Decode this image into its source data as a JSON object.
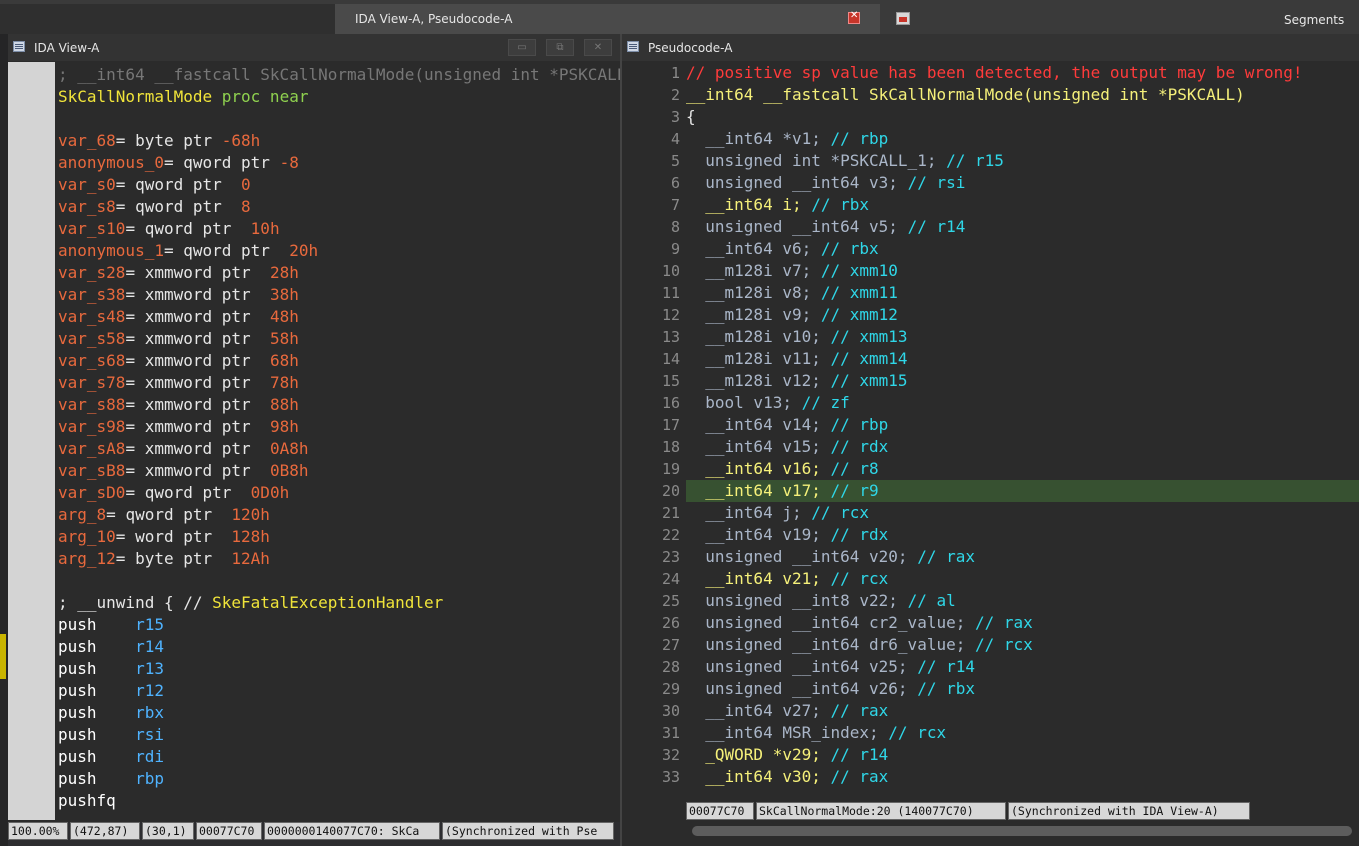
{
  "tabs": {
    "main_title": "IDA View-A, Pseudocode-A",
    "segments": "Segments"
  },
  "left_pane": {
    "title": "IDA View-A",
    "lines": [
      [
        {
          "t": "; __int64 __fastcall SkCallNormalMode(unsigned int *PSKCALL",
          "c": "#777777"
        }
      ],
      [
        {
          "t": "SkCallNormalMode ",
          "c": "#f0e43a"
        },
        {
          "t": "proc near",
          "c": "#8fd14f"
        }
      ],
      [
        {
          "t": "",
          "c": "#fff"
        }
      ],
      [
        {
          "t": "var_68",
          "c": "#e8693d"
        },
        {
          "t": "= byte ptr ",
          "c": "#e6e6e6"
        },
        {
          "t": "-68h",
          "c": "#e8693d"
        }
      ],
      [
        {
          "t": "anonymous_0",
          "c": "#e8693d"
        },
        {
          "t": "= qword ptr ",
          "c": "#e6e6e6"
        },
        {
          "t": "-8",
          "c": "#e8693d"
        }
      ],
      [
        {
          "t": "var_s0",
          "c": "#e8693d"
        },
        {
          "t": "= qword ptr  ",
          "c": "#e6e6e6"
        },
        {
          "t": "0",
          "c": "#e8693d"
        }
      ],
      [
        {
          "t": "var_s8",
          "c": "#e8693d"
        },
        {
          "t": "= qword ptr  ",
          "c": "#e6e6e6"
        },
        {
          "t": "8",
          "c": "#e8693d"
        }
      ],
      [
        {
          "t": "var_s10",
          "c": "#e8693d"
        },
        {
          "t": "= qword ptr  ",
          "c": "#e6e6e6"
        },
        {
          "t": "10h",
          "c": "#e8693d"
        }
      ],
      [
        {
          "t": "anonymous_1",
          "c": "#e8693d"
        },
        {
          "t": "= qword ptr  ",
          "c": "#e6e6e6"
        },
        {
          "t": "20h",
          "c": "#e8693d"
        }
      ],
      [
        {
          "t": "var_s28",
          "c": "#e8693d"
        },
        {
          "t": "= xmmword ptr  ",
          "c": "#e6e6e6"
        },
        {
          "t": "28h",
          "c": "#e8693d"
        }
      ],
      [
        {
          "t": "var_s38",
          "c": "#e8693d"
        },
        {
          "t": "= xmmword ptr  ",
          "c": "#e6e6e6"
        },
        {
          "t": "38h",
          "c": "#e8693d"
        }
      ],
      [
        {
          "t": "var_s48",
          "c": "#e8693d"
        },
        {
          "t": "= xmmword ptr  ",
          "c": "#e6e6e6"
        },
        {
          "t": "48h",
          "c": "#e8693d"
        }
      ],
      [
        {
          "t": "var_s58",
          "c": "#e8693d"
        },
        {
          "t": "= xmmword ptr  ",
          "c": "#e6e6e6"
        },
        {
          "t": "58h",
          "c": "#e8693d"
        }
      ],
      [
        {
          "t": "var_s68",
          "c": "#e8693d"
        },
        {
          "t": "= xmmword ptr  ",
          "c": "#e6e6e6"
        },
        {
          "t": "68h",
          "c": "#e8693d"
        }
      ],
      [
        {
          "t": "var_s78",
          "c": "#e8693d"
        },
        {
          "t": "= xmmword ptr  ",
          "c": "#e6e6e6"
        },
        {
          "t": "78h",
          "c": "#e8693d"
        }
      ],
      [
        {
          "t": "var_s88",
          "c": "#e8693d"
        },
        {
          "t": "= xmmword ptr  ",
          "c": "#e6e6e6"
        },
        {
          "t": "88h",
          "c": "#e8693d"
        }
      ],
      [
        {
          "t": "var_s98",
          "c": "#e8693d"
        },
        {
          "t": "= xmmword ptr  ",
          "c": "#e6e6e6"
        },
        {
          "t": "98h",
          "c": "#e8693d"
        }
      ],
      [
        {
          "t": "var_sA8",
          "c": "#e8693d"
        },
        {
          "t": "= xmmword ptr  ",
          "c": "#e6e6e6"
        },
        {
          "t": "0A8h",
          "c": "#e8693d"
        }
      ],
      [
        {
          "t": "var_sB8",
          "c": "#e8693d"
        },
        {
          "t": "= xmmword ptr  ",
          "c": "#e6e6e6"
        },
        {
          "t": "0B8h",
          "c": "#e8693d"
        }
      ],
      [
        {
          "t": "var_sD0",
          "c": "#e8693d"
        },
        {
          "t": "= qword ptr  ",
          "c": "#e6e6e6"
        },
        {
          "t": "0D0h",
          "c": "#e8693d"
        }
      ],
      [
        {
          "t": "arg_8",
          "c": "#e8693d"
        },
        {
          "t": "= qword ptr  ",
          "c": "#e6e6e6"
        },
        {
          "t": "120h",
          "c": "#e8693d"
        }
      ],
      [
        {
          "t": "arg_10",
          "c": "#e8693d"
        },
        {
          "t": "= word ptr  ",
          "c": "#e6e6e6"
        },
        {
          "t": "128h",
          "c": "#e8693d"
        }
      ],
      [
        {
          "t": "arg_12",
          "c": "#e8693d"
        },
        {
          "t": "= byte ptr  ",
          "c": "#e6e6e6"
        },
        {
          "t": "12Ah",
          "c": "#e8693d"
        }
      ],
      [
        {
          "t": "",
          "c": "#fff"
        }
      ],
      [
        {
          "t": "; __unwind { // ",
          "c": "#e6e6e6"
        },
        {
          "t": "SkeFatalExceptionHandler",
          "c": "#f0e43a"
        }
      ],
      [
        {
          "t": "push    ",
          "c": "#ffffff"
        },
        {
          "t": "r15",
          "c": "#4fb3ff"
        }
      ],
      [
        {
          "t": "push    ",
          "c": "#ffffff"
        },
        {
          "t": "r14",
          "c": "#4fb3ff"
        }
      ],
      [
        {
          "t": "push    ",
          "c": "#ffffff"
        },
        {
          "t": "r13",
          "c": "#4fb3ff"
        }
      ],
      [
        {
          "t": "push    ",
          "c": "#ffffff"
        },
        {
          "t": "r12",
          "c": "#4fb3ff"
        }
      ],
      [
        {
          "t": "push    ",
          "c": "#ffffff"
        },
        {
          "t": "rbx",
          "c": "#4fb3ff"
        }
      ],
      [
        {
          "t": "push    ",
          "c": "#ffffff"
        },
        {
          "t": "rsi",
          "c": "#4fb3ff"
        }
      ],
      [
        {
          "t": "push    ",
          "c": "#ffffff"
        },
        {
          "t": "rdi",
          "c": "#4fb3ff"
        }
      ],
      [
        {
          "t": "push    ",
          "c": "#ffffff"
        },
        {
          "t": "rbp",
          "c": "#4fb3ff"
        }
      ],
      [
        {
          "t": "pushfq",
          "c": "#ffffff"
        }
      ]
    ],
    "status": [
      "100.00%",
      "(472,87)",
      "(30,1)",
      "00077C70",
      "0000000140077C70: SkCa",
      "(Synchronized with Pse"
    ]
  },
  "right_pane": {
    "title": "Pseudocode-A",
    "lines": [
      [
        {
          "t": "// positive sp value has been detected, the output may be wrong!",
          "c": "#ff3b3b"
        }
      ],
      [
        {
          "t": "__int64 __fastcall SkCallNormalMode(unsigned int *PSKCALL)",
          "c": "#f5f07a"
        }
      ],
      [
        {
          "t": "{",
          "c": "#e6e6e6"
        }
      ],
      [
        {
          "t": "  __int64 *v1; ",
          "c": "#aab6c8"
        },
        {
          "t": "// rbp",
          "c": "#2fd7e8"
        }
      ],
      [
        {
          "t": "  unsigned int *PSKCALL_1; ",
          "c": "#aab6c8"
        },
        {
          "t": "// r15",
          "c": "#2fd7e8"
        }
      ],
      [
        {
          "t": "  unsigned __int64 v3; ",
          "c": "#aab6c8"
        },
        {
          "t": "// rsi",
          "c": "#2fd7e8"
        }
      ],
      [
        {
          "t": "  __int64 i; ",
          "c": "#f5f07a"
        },
        {
          "t": "// rbx",
          "c": "#2fd7e8"
        }
      ],
      [
        {
          "t": "  unsigned __int64 v5; ",
          "c": "#aab6c8"
        },
        {
          "t": "// r14",
          "c": "#2fd7e8"
        }
      ],
      [
        {
          "t": "  __int64 v6; ",
          "c": "#aab6c8"
        },
        {
          "t": "// rbx",
          "c": "#2fd7e8"
        }
      ],
      [
        {
          "t": "  __m128i v7; ",
          "c": "#aab6c8"
        },
        {
          "t": "// xmm10",
          "c": "#2fd7e8"
        }
      ],
      [
        {
          "t": "  __m128i v8; ",
          "c": "#aab6c8"
        },
        {
          "t": "// xmm11",
          "c": "#2fd7e8"
        }
      ],
      [
        {
          "t": "  __m128i v9; ",
          "c": "#aab6c8"
        },
        {
          "t": "// xmm12",
          "c": "#2fd7e8"
        }
      ],
      [
        {
          "t": "  __m128i v10; ",
          "c": "#aab6c8"
        },
        {
          "t": "// xmm13",
          "c": "#2fd7e8"
        }
      ],
      [
        {
          "t": "  __m128i v11; ",
          "c": "#aab6c8"
        },
        {
          "t": "// xmm14",
          "c": "#2fd7e8"
        }
      ],
      [
        {
          "t": "  __m128i v12; ",
          "c": "#aab6c8"
        },
        {
          "t": "// xmm15",
          "c": "#2fd7e8"
        }
      ],
      [
        {
          "t": "  bool v13; ",
          "c": "#aab6c8"
        },
        {
          "t": "// zf",
          "c": "#2fd7e8"
        }
      ],
      [
        {
          "t": "  __int64 v14; ",
          "c": "#aab6c8"
        },
        {
          "t": "// rbp",
          "c": "#2fd7e8"
        }
      ],
      [
        {
          "t": "  __int64 v15; ",
          "c": "#aab6c8"
        },
        {
          "t": "// rdx",
          "c": "#2fd7e8"
        }
      ],
      [
        {
          "t": "  __int64 v16; ",
          "c": "#f5f07a"
        },
        {
          "t": "// r8",
          "c": "#2fd7e8"
        }
      ],
      [
        {
          "t": "  __int64 v17; ",
          "c": "#f5f07a"
        },
        {
          "t": "// r9",
          "c": "#2fd7e8"
        }
      ],
      [
        {
          "t": "  __int64 j; ",
          "c": "#aab6c8"
        },
        {
          "t": "// rcx",
          "c": "#2fd7e8"
        }
      ],
      [
        {
          "t": "  __int64 v19; ",
          "c": "#aab6c8"
        },
        {
          "t": "// rdx",
          "c": "#2fd7e8"
        }
      ],
      [
        {
          "t": "  unsigned __int64 v20; ",
          "c": "#aab6c8"
        },
        {
          "t": "// rax",
          "c": "#2fd7e8"
        }
      ],
      [
        {
          "t": "  __int64 v21; ",
          "c": "#f5f07a"
        },
        {
          "t": "// rcx",
          "c": "#2fd7e8"
        }
      ],
      [
        {
          "t": "  unsigned __int8 v22; ",
          "c": "#aab6c8"
        },
        {
          "t": "// al",
          "c": "#2fd7e8"
        }
      ],
      [
        {
          "t": "  unsigned __int64 cr2_value; ",
          "c": "#aab6c8"
        },
        {
          "t": "// rax",
          "c": "#2fd7e8"
        }
      ],
      [
        {
          "t": "  unsigned __int64 dr6_value; ",
          "c": "#aab6c8"
        },
        {
          "t": "// rcx",
          "c": "#2fd7e8"
        }
      ],
      [
        {
          "t": "  unsigned __int64 v25; ",
          "c": "#aab6c8"
        },
        {
          "t": "// r14",
          "c": "#2fd7e8"
        }
      ],
      [
        {
          "t": "  unsigned __int64 v26; ",
          "c": "#aab6c8"
        },
        {
          "t": "// rbx",
          "c": "#2fd7e8"
        }
      ],
      [
        {
          "t": "  __int64 v27; ",
          "c": "#aab6c8"
        },
        {
          "t": "// rax",
          "c": "#2fd7e8"
        }
      ],
      [
        {
          "t": "  __int64 MSR_index; ",
          "c": "#aab6c8"
        },
        {
          "t": "// rcx",
          "c": "#2fd7e8"
        }
      ],
      [
        {
          "t": "  _QWORD *v29; ",
          "c": "#f5f07a"
        },
        {
          "t": "// r14",
          "c": "#2fd7e8"
        }
      ],
      [
        {
          "t": "  __int64 v30; ",
          "c": "#f5f07a"
        },
        {
          "t": "// rax",
          "c": "#2fd7e8"
        }
      ]
    ],
    "line_numbers": [
      "1",
      "2",
      "3",
      "4",
      "5",
      "6",
      "7",
      "8",
      "9",
      "10",
      "11",
      "12",
      "13",
      "14",
      "15",
      "16",
      "17",
      "18",
      "19",
      "20",
      "21",
      "22",
      "23",
      "24",
      "25",
      "26",
      "27",
      "28",
      "29",
      "30",
      "31",
      "32",
      "33"
    ],
    "highlighted_line": 20,
    "status": [
      "00077C70",
      "SkCallNormalMode:20 (140077C70)",
      "(Synchronized with IDA View-A)"
    ]
  }
}
